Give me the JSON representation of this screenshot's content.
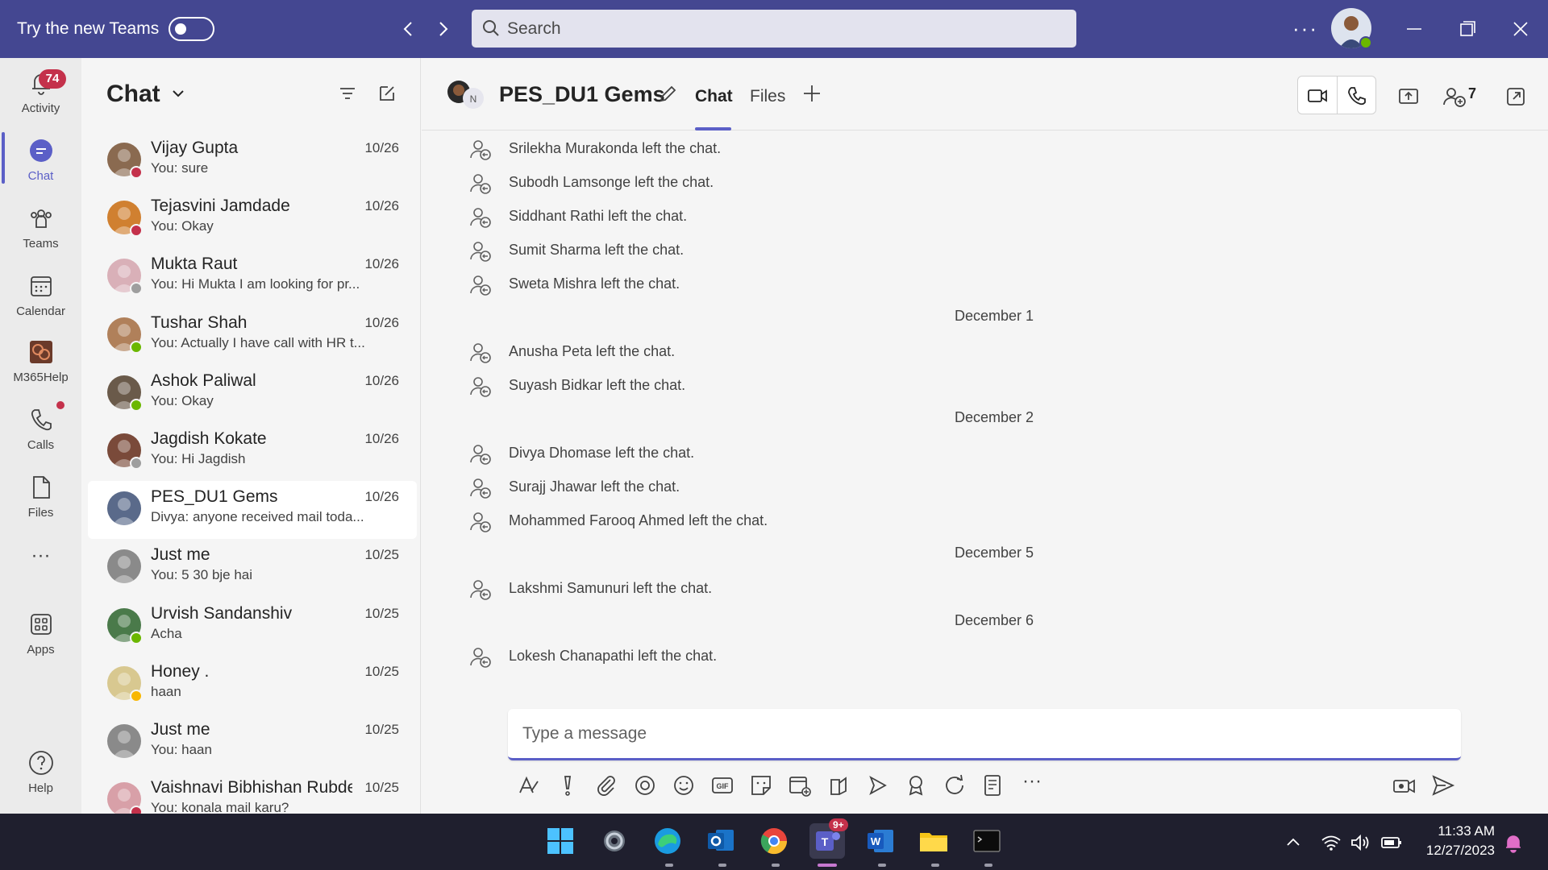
{
  "titlebar": {
    "try_label": "Try the new Teams",
    "search_placeholder": "Search",
    "more": "···"
  },
  "rail": {
    "items": [
      {
        "label": "Activity",
        "badge": "74"
      },
      {
        "label": "Chat"
      },
      {
        "label": "Teams"
      },
      {
        "label": "Calendar"
      },
      {
        "label": "M365Help"
      },
      {
        "label": "Calls"
      },
      {
        "label": "Files"
      },
      {
        "label": "···"
      },
      {
        "label": "Apps"
      },
      {
        "label": "Help"
      }
    ]
  },
  "chatlist": {
    "title": "Chat",
    "items": [
      {
        "name": "Vijay Gupta",
        "date": "10/26",
        "preview": "You: sure",
        "presence": "#c4314b",
        "avatar": "#8a6a50"
      },
      {
        "name": "Tejasvini Jamdade",
        "date": "10/26",
        "preview": "You: Okay",
        "presence": "#c4314b",
        "avatar": "#d08030"
      },
      {
        "name": "Mukta Raut",
        "date": "10/26",
        "preview": "You: Hi Mukta I am looking for pr...",
        "presence": "#9e9e9e",
        "avatar": "#d9b0b8"
      },
      {
        "name": "Tushar Shah",
        "date": "10/26",
        "preview": "You: Actually I have call with HR t...",
        "presence": "#6bb700",
        "avatar": "#b0805a"
      },
      {
        "name": "Ashok Paliwal",
        "date": "10/26",
        "preview": "You: Okay",
        "presence": "#6bb700",
        "avatar": "#6a5a4a"
      },
      {
        "name": "Jagdish Kokate",
        "date": "10/26",
        "preview": "You: Hi Jagdish",
        "presence": "#9e9e9e",
        "avatar": "#7a4a3a"
      },
      {
        "name": "PES_DU1 Gems",
        "date": "10/26",
        "preview": "Divya: anyone received mail toda...",
        "presence": "",
        "avatar": "#5a6a8a"
      },
      {
        "name": "Just me",
        "date": "10/25",
        "preview": "You: 5 30 bje hai",
        "presence": "",
        "avatar": "#8a8a8a"
      },
      {
        "name": "Urvish Sandanshiv",
        "date": "10/25",
        "preview": "Acha",
        "presence": "#6bb700",
        "avatar": "#4a7a4a"
      },
      {
        "name": "Honey .",
        "date": "10/25",
        "preview": "haan",
        "presence": "#f8b700",
        "avatar": "#d8c890"
      },
      {
        "name": "Just me",
        "date": "10/25",
        "preview": "You: haan",
        "presence": "",
        "avatar": "#8a8a8a"
      },
      {
        "name": "Vaishnavi Bibhishan Rubde",
        "date": "10/25",
        "preview": "You: konala mail karu?",
        "presence": "#c4314b",
        "avatar": "#d8a0a8"
      }
    ]
  },
  "main": {
    "title": "PES_DU1 Gems",
    "tabs": [
      "Chat",
      "Files"
    ],
    "participants": "7",
    "events": [
      {
        "type": "event",
        "text": "Srilekha Murakonda left the chat."
      },
      {
        "type": "event",
        "text": "Subodh Lamsonge left the chat."
      },
      {
        "type": "event",
        "text": "Siddhant Rathi left the chat."
      },
      {
        "type": "event",
        "text": "Sumit Sharma left the chat."
      },
      {
        "type": "event",
        "text": "Sweta Mishra left the chat."
      },
      {
        "type": "date",
        "text": "December 1"
      },
      {
        "type": "event",
        "text": "Anusha Peta left the chat."
      },
      {
        "type": "event",
        "text": "Suyash Bidkar left the chat."
      },
      {
        "type": "date",
        "text": "December 2"
      },
      {
        "type": "event",
        "text": "Divya Dhomase left the chat."
      },
      {
        "type": "event",
        "text": "Surajj Jhawar left the chat."
      },
      {
        "type": "event",
        "text": "Mohammed Farooq Ahmed left the chat."
      },
      {
        "type": "date",
        "text": "December 5"
      },
      {
        "type": "event",
        "text": "Lakshmi Samunuri left the chat."
      },
      {
        "type": "date",
        "text": "December 6"
      },
      {
        "type": "event",
        "text": "Lokesh Chanapathi left the chat."
      }
    ],
    "compose_placeholder": "Type a message",
    "more_tools": "···"
  },
  "taskbar": {
    "teams_badge": "9+",
    "time": "11:33 AM",
    "date": "12/27/2023"
  },
  "colors": {
    "accent": "#5b5fc7",
    "titlebar": "#444791",
    "badge": "#c4314b",
    "available": "#6bb700",
    "busy": "#c4314b",
    "away": "#f8b700"
  }
}
